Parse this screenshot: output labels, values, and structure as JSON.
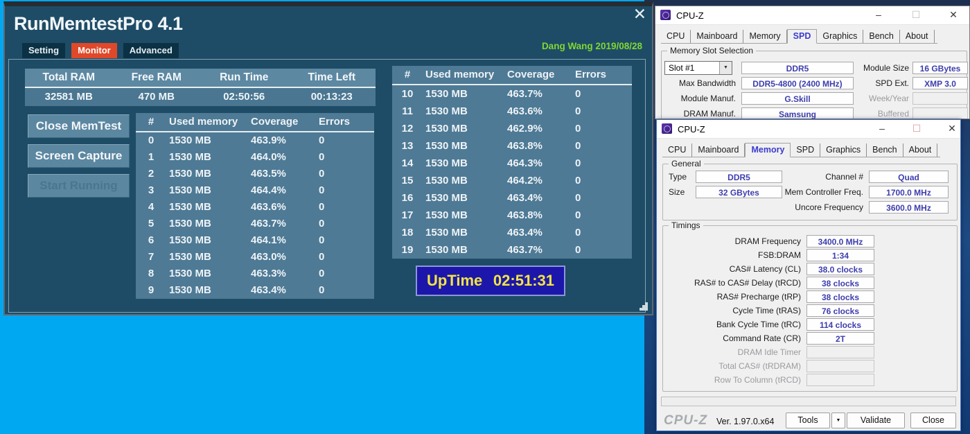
{
  "colors": {
    "desktop_blue": "#00a7f1",
    "memtest_window_bg": "#1e4c66",
    "memtest_panel_bg": "#4e7a95",
    "monitor_tab_red": "#e0482a",
    "author_green": "#7fd832",
    "uptime_bg": "#1c17aa",
    "uptime_text": "#f2e544",
    "cpuz_value_indigo": "#3d3dae"
  },
  "memtest": {
    "title": "RunMemtestPro 4.1",
    "close_icon": "✕",
    "author": "Dang Wang 2019/08/28",
    "tabs": [
      {
        "label": "Setting"
      },
      {
        "label": "Monitor"
      },
      {
        "label": "Advanced"
      }
    ],
    "stats": {
      "headers": [
        "Total RAM",
        "Free RAM",
        "Run Time",
        "Time Left"
      ],
      "values": [
        "32581 MB",
        "470 MB",
        "02:50:56",
        "00:13:23"
      ]
    },
    "buttons": {
      "close": "Close MemTest",
      "capture": "Screen Capture",
      "start": "Start Running"
    },
    "table_headers": [
      "#",
      "Used memory",
      "Coverage",
      "Errors"
    ],
    "left_rows": [
      {
        "n": "0",
        "used": "1530 MB",
        "coverage": "463.9%",
        "errors": "0"
      },
      {
        "n": "1",
        "used": "1530 MB",
        "coverage": "464.0%",
        "errors": "0"
      },
      {
        "n": "2",
        "used": "1530 MB",
        "coverage": "463.5%",
        "errors": "0"
      },
      {
        "n": "3",
        "used": "1530 MB",
        "coverage": "464.4%",
        "errors": "0"
      },
      {
        "n": "4",
        "used": "1530 MB",
        "coverage": "463.6%",
        "errors": "0"
      },
      {
        "n": "5",
        "used": "1530 MB",
        "coverage": "463.7%",
        "errors": "0"
      },
      {
        "n": "6",
        "used": "1530 MB",
        "coverage": "464.1%",
        "errors": "0"
      },
      {
        "n": "7",
        "used": "1530 MB",
        "coverage": "463.0%",
        "errors": "0"
      },
      {
        "n": "8",
        "used": "1530 MB",
        "coverage": "463.3%",
        "errors": "0"
      },
      {
        "n": "9",
        "used": "1530 MB",
        "coverage": "463.4%",
        "errors": "0"
      }
    ],
    "right_rows": [
      {
        "n": "10",
        "used": "1530 MB",
        "coverage": "463.7%",
        "errors": "0"
      },
      {
        "n": "11",
        "used": "1530 MB",
        "coverage": "463.6%",
        "errors": "0"
      },
      {
        "n": "12",
        "used": "1530 MB",
        "coverage": "462.9%",
        "errors": "0"
      },
      {
        "n": "13",
        "used": "1530 MB",
        "coverage": "463.8%",
        "errors": "0"
      },
      {
        "n": "14",
        "used": "1530 MB",
        "coverage": "464.3%",
        "errors": "0"
      },
      {
        "n": "15",
        "used": "1530 MB",
        "coverage": "464.2%",
        "errors": "0"
      },
      {
        "n": "16",
        "used": "1530 MB",
        "coverage": "463.4%",
        "errors": "0"
      },
      {
        "n": "17",
        "used": "1530 MB",
        "coverage": "463.8%",
        "errors": "0"
      },
      {
        "n": "18",
        "used": "1530 MB",
        "coverage": "463.4%",
        "errors": "0"
      },
      {
        "n": "19",
        "used": "1530 MB",
        "coverage": "463.7%",
        "errors": "0"
      }
    ],
    "uptime": {
      "label": "UpTime",
      "value": "02:51:31"
    }
  },
  "cpuz_spd": {
    "title": "CPU-Z",
    "controls": {
      "minimize": "–",
      "maximize": "☐",
      "close": "✕"
    },
    "tabs": [
      "CPU",
      "Mainboard",
      "Memory",
      "SPD",
      "Graphics",
      "Bench",
      "About"
    ],
    "selected_tab": "SPD",
    "group": "Memory Slot Selection",
    "slot_selected": "Slot #1",
    "dropdown_icon": "▼",
    "slot_type": "DDR5",
    "module_size_label": "Module Size",
    "module_size": "16 GBytes",
    "max_bandwidth_label": "Max Bandwidth",
    "max_bandwidth": "DDR5-4800 (2400 MHz)",
    "spd_ext_label": "SPD Ext.",
    "spd_ext": "XMP 3.0",
    "module_manuf_label": "Module Manuf.",
    "module_manuf": "G.Skill",
    "week_year_label": "Week/Year",
    "week_year": "",
    "dram_manuf_label": "DRAM Manuf.",
    "dram_manuf": "Samsung",
    "buffered_label": "Buffered",
    "buffered": ""
  },
  "cpuz_memory": {
    "title": "CPU-Z",
    "controls": {
      "minimize": "–",
      "maximize": "☐",
      "close": "✕"
    },
    "tabs": [
      "CPU",
      "Mainboard",
      "Memory",
      "SPD",
      "Graphics",
      "Bench",
      "About"
    ],
    "selected_tab": "Memory",
    "general": {
      "group": "General",
      "type_label": "Type",
      "type": "DDR5",
      "size_label": "Size",
      "size": "32 GBytes",
      "channel_label": "Channel #",
      "channel": "Quad",
      "mem_ctrl_label": "Mem Controller Freq.",
      "mem_ctrl": "1700.0 MHz",
      "uncore_label": "Uncore Frequency",
      "uncore": "3600.0 MHz"
    },
    "timings": {
      "group": "Timings",
      "rows": [
        {
          "label": "DRAM Frequency",
          "value": "3400.0 MHz"
        },
        {
          "label": "FSB:DRAM",
          "value": "1:34"
        },
        {
          "label": "CAS# Latency (CL)",
          "value": "38.0 clocks"
        },
        {
          "label": "RAS# to CAS# Delay (tRCD)",
          "value": "38 clocks"
        },
        {
          "label": "RAS# Precharge (tRP)",
          "value": "38 clocks"
        },
        {
          "label": "Cycle Time (tRAS)",
          "value": "76 clocks"
        },
        {
          "label": "Bank Cycle Time (tRC)",
          "value": "114 clocks"
        },
        {
          "label": "Command Rate (CR)",
          "value": "2T"
        },
        {
          "label": "DRAM Idle Timer",
          "value": ""
        },
        {
          "label": "Total CAS# (tRDRAM)",
          "value": ""
        },
        {
          "label": "Row To Column (tRCD)",
          "value": ""
        }
      ]
    },
    "footer": {
      "logo": "CPU-Z",
      "version": "Ver. 1.97.0.x64",
      "tools": "Tools",
      "dropdown_icon": "▼",
      "validate": "Validate",
      "close": "Close"
    }
  }
}
